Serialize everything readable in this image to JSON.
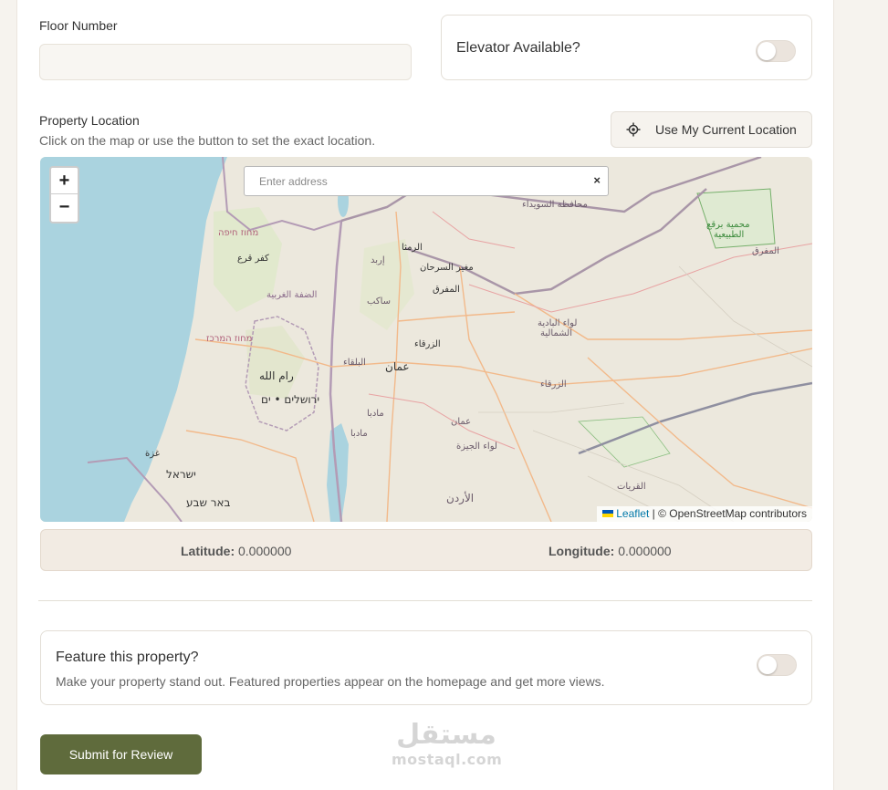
{
  "floor": {
    "label": "Floor Number",
    "value": "",
    "placeholder": ""
  },
  "elevator": {
    "label": "Elevator Available?",
    "on": false
  },
  "location": {
    "label": "Property Location",
    "hint": "Click on the map or use the button to set the exact location.",
    "button_label": "Use My Current Location"
  },
  "map": {
    "zoom_in": "+",
    "zoom_out": "−",
    "address_placeholder": "Enter address",
    "clear": "×",
    "attribution_link": "Leaflet",
    "attribution_text": " | © OpenStreetMap contributors",
    "places": [
      "محافظة السويداء",
      "محمية برقع",
      "الطبيعية",
      "المفرق",
      "מחוז חיפה",
      "الرمثا",
      "إربد",
      "مغير السرحان",
      "كفر قرع",
      "الضفة الغربية",
      "المفرق",
      "ساكب",
      "لواء البادية",
      "الشمالية",
      "מחוז המרכז",
      "الزرقاء",
      "البلقاء",
      "عمان",
      "رام الله",
      "الزرقاء",
      "ירושלים • ים",
      "مادبا",
      "عمان",
      "مادبا",
      "غزة",
      "لواء الجيزة",
      "ישראל",
      "القريات",
      "באר שבע",
      "الأردن"
    ]
  },
  "coords": {
    "lat_label": "Latitude:",
    "lat_value": "0.000000",
    "lng_label": "Longitude:",
    "lng_value": "0.000000"
  },
  "featured": {
    "title": "Feature this property?",
    "description": "Make your property stand out. Featured properties appear on the homepage and get more views.",
    "on": false
  },
  "submit_label": "Submit for Review",
  "watermark": {
    "arabic": "مستقل",
    "latin": "mostaql.com"
  },
  "colors": {
    "primary": "#5f6b3c",
    "coords_bg": "#f2ebe3",
    "water": "#aad3df"
  }
}
